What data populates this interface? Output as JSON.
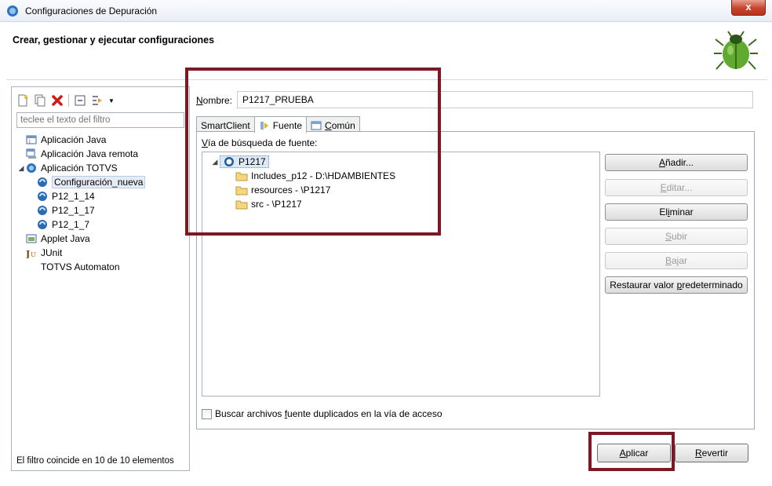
{
  "window": {
    "title": "Configuraciones de Depuración",
    "close_label": "x"
  },
  "header": {
    "title": "Crear, gestionar y ejecutar configuraciones"
  },
  "left_panel": {
    "filter_placeholder": "teclee el texto del filtro",
    "tree": [
      {
        "label": "Aplicación Java",
        "icon": "java-app-icon",
        "level": 0
      },
      {
        "label": "Aplicación Java remota",
        "icon": "remote-java-icon",
        "level": 0
      },
      {
        "label": "Aplicación TOTVS",
        "icon": "totvs-icon",
        "level": 0,
        "expanded": true
      },
      {
        "label": "Configuración_nueva",
        "icon": "totvs-config-icon",
        "level": 1,
        "selected": true
      },
      {
        "label": "P12_1_14",
        "icon": "totvs-config-icon",
        "level": 1
      },
      {
        "label": "P12_1_17",
        "icon": "totvs-config-icon",
        "level": 1
      },
      {
        "label": "P12_1_7",
        "icon": "totvs-config-icon",
        "level": 1
      },
      {
        "label": "Applet Java",
        "icon": "applet-icon",
        "level": 0
      },
      {
        "label": "JUnit",
        "icon": "junit-icon",
        "level": 0
      },
      {
        "label": "TOTVS Automaton",
        "icon": "none",
        "level": 0
      }
    ],
    "status": "El filtro coincide en 10 de 10 elementos"
  },
  "right_panel": {
    "name_label": "Nombre:",
    "name_value": "P1217_PRUEBA",
    "tabs": [
      {
        "label": "SmartClient",
        "active": false
      },
      {
        "label": "Fuente",
        "active": true
      },
      {
        "label": "Común",
        "active": false
      }
    ],
    "source_path_label": "Vía de búsqueda de fuente:",
    "source_tree": {
      "project": "P1217",
      "children": [
        "Includes_p12 - D:\\HDAMBIENTES",
        "resources - \\P1217",
        "src - \\P1217"
      ]
    },
    "buttons": {
      "add": "Añadir...",
      "edit": "Editar...",
      "remove": "Eliminar",
      "up": "Subir",
      "down": "Bajar",
      "restore": "Restaurar valor predeterminado"
    },
    "checkbox_label": "Buscar archivos fuente duplicados en la vía de acceso"
  },
  "footer": {
    "apply": "Aplicar",
    "revert": "Revertir"
  },
  "colors": {
    "highlight": "#7b1a24",
    "selection": "#e5ecf6"
  }
}
